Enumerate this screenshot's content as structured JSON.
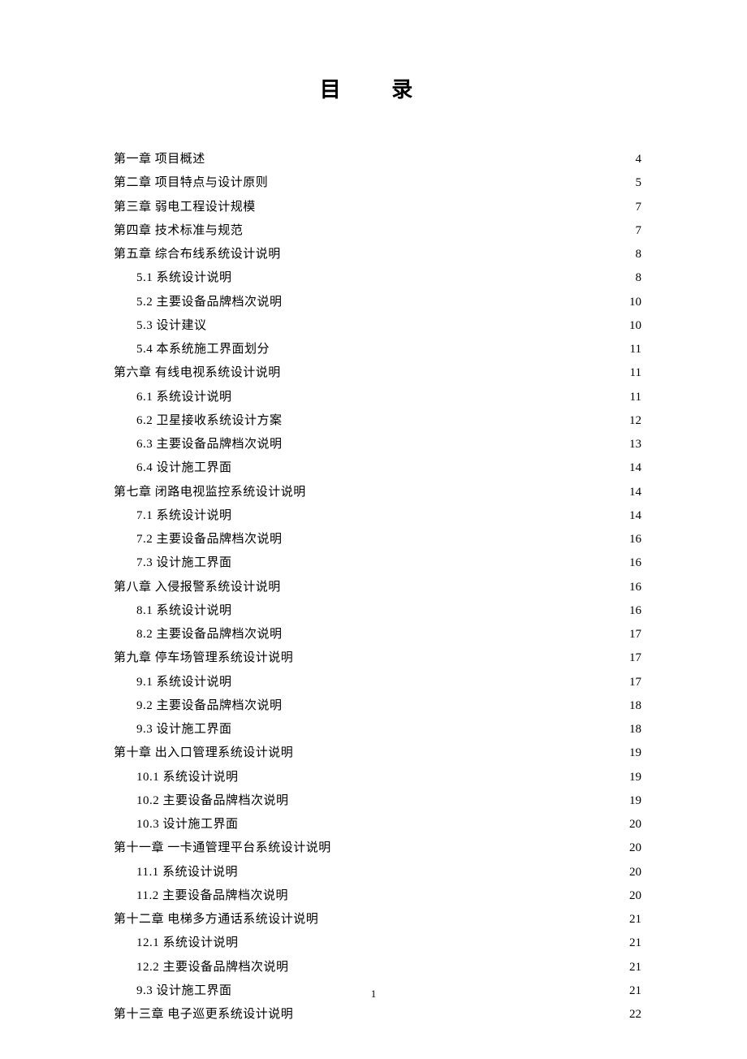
{
  "title": "目 录",
  "footer_page": "1",
  "toc": [
    {
      "level": 1,
      "label": "第一章 项目概述",
      "page": "4"
    },
    {
      "level": 1,
      "label": "第二章 项目特点与设计原则",
      "page": "5"
    },
    {
      "level": 1,
      "label": "第三章 弱电工程设计规模",
      "page": "7"
    },
    {
      "level": 1,
      "label": "第四章 技术标准与规范",
      "page": "7"
    },
    {
      "level": 1,
      "label": "第五章 综合布线系统设计说明",
      "page": "8"
    },
    {
      "level": 2,
      "label": "5.1 系统设计说明 ",
      "page": "8"
    },
    {
      "level": 2,
      "label": "5.2 主要设备品牌档次说明 ",
      "page": "10"
    },
    {
      "level": 2,
      "label": "5.3 设计建议 ",
      "page": "10"
    },
    {
      "level": 2,
      "label": "5.4 本系统施工界面划分 ",
      "page": "11"
    },
    {
      "level": 1,
      "label": "第六章 有线电视系统设计说明",
      "page": "11"
    },
    {
      "level": 2,
      "label": "6.1 系统设计说明",
      "page": "11"
    },
    {
      "level": 2,
      "label": "6.2 卫星接收系统设计方案",
      "page": "12"
    },
    {
      "level": 2,
      "label": "6.3 主要设备品牌档次说明",
      "page": "13"
    },
    {
      "level": 2,
      "label": "6.4 设计施工界面",
      "page": "14"
    },
    {
      "level": 1,
      "label": "第七章 闭路电视监控系统设计说明",
      "page": "14"
    },
    {
      "level": 2,
      "label": "7.1 系统设计说明 ",
      "page": "14"
    },
    {
      "level": 2,
      "label": "7.2 主要设备品牌档次说明",
      "page": "16"
    },
    {
      "level": 2,
      "label": "7.3 设计施工界面 ",
      "page": "16"
    },
    {
      "level": 1,
      "label": "第八章 入侵报警系统设计说明",
      "page": "16"
    },
    {
      "level": 2,
      "label": "8.1 系统设计说明",
      "page": "16"
    },
    {
      "level": 2,
      "label": "8.2 主要设备品牌档次说明",
      "page": "17"
    },
    {
      "level": 1,
      "label": "第九章 停车场管理系统设计说明",
      "page": "17"
    },
    {
      "level": 2,
      "label": "9.1 系统设计说明",
      "page": "17"
    },
    {
      "level": 2,
      "label": "9.2 主要设备品牌档次说明",
      "page": "18"
    },
    {
      "level": 2,
      "label": "9.3 设计施工界面",
      "page": "18"
    },
    {
      "level": 1,
      "label": "第十章 出入口管理系统设计说明",
      "page": "19"
    },
    {
      "level": 2,
      "label": "10.1 系统设计说明",
      "page": "19"
    },
    {
      "level": 2,
      "label": "10.2 主要设备品牌档次说明",
      "page": "19"
    },
    {
      "level": 2,
      "label": "10.3 设计施工界面 ",
      "page": "20"
    },
    {
      "level": 1,
      "label": "第十一章 一卡通管理平台系统设计说明",
      "page": "20"
    },
    {
      "level": 2,
      "label": "11.1 系统设计说明",
      "page": "20"
    },
    {
      "level": 2,
      "label": "11.2 主要设备品牌档次说明",
      "page": "20"
    },
    {
      "level": 1,
      "label": "第十二章 电梯多方通话系统设计说明",
      "page": "21"
    },
    {
      "level": 2,
      "label": "12.1 系统设计说明",
      "page": "21"
    },
    {
      "level": 2,
      "label": "12.2 主要设备品牌档次说明",
      "page": "21"
    },
    {
      "level": 2,
      "label": "9.3 设计施工界面",
      "page": "21"
    },
    {
      "level": 1,
      "label": "第十三章 电子巡更系统设计说明",
      "page": "22"
    }
  ]
}
